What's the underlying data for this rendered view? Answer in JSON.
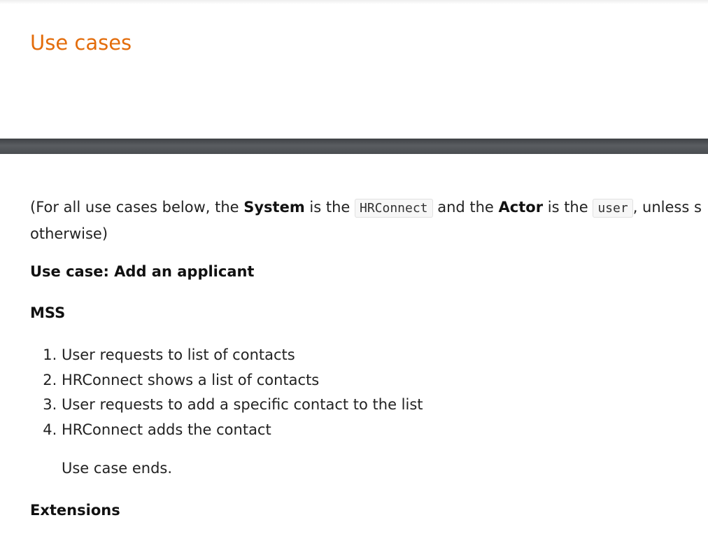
{
  "section": {
    "title": "Use cases"
  },
  "intro": {
    "prefix": "(For all use cases below, the ",
    "system_label": "System",
    "is_the_1": " is the ",
    "system_code": "HRConnect",
    "and_the": " and the ",
    "actor_label": "Actor",
    "is_the_2": " is the ",
    "actor_code": "user",
    "suffix_line1": ", unless s",
    "line2": "otherwise)"
  },
  "use_case": {
    "heading": "Use case: Add an applicant",
    "mss_heading": "MSS",
    "steps": [
      "User requests to list of contacts",
      "HRConnect shows a list of contacts",
      "User requests to add a specific contact to the list",
      "HRConnect adds the contact"
    ],
    "ends_text": "Use case ends.",
    "extensions_heading": "Extensions"
  },
  "colors": {
    "heading_accent": "#e36c0a",
    "divider": "#4a4d51"
  }
}
